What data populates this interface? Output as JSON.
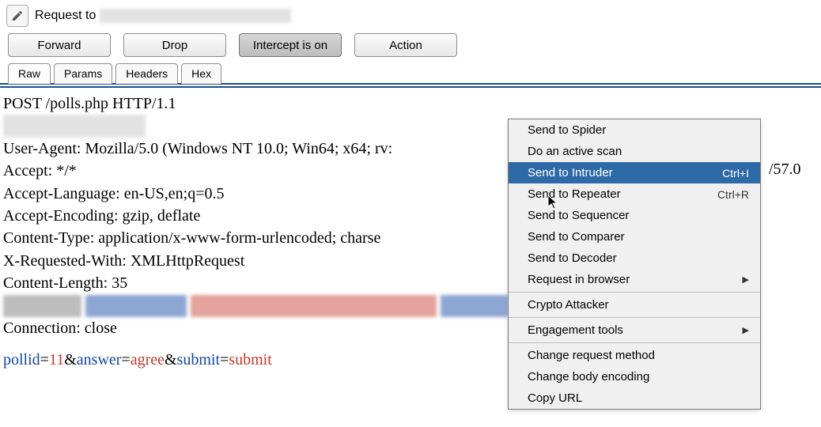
{
  "header": {
    "request_label_prefix": "Request to",
    "request_target_redacted": "████████████  [██ ██ █ ██]"
  },
  "buttons": {
    "forward": "Forward",
    "drop": "Drop",
    "intercept": "Intercept is on",
    "action": "Action"
  },
  "tabs": [
    "Raw",
    "Params",
    "Headers",
    "Hex"
  ],
  "active_tab": "Raw",
  "request": {
    "request_line": "POST /polls.php HTTP/1.1",
    "host_redacted": "████ ██████ ██",
    "user_agent": "User-Agent: Mozilla/5.0 (Windows NT 10.0; Win64; x64; rv:",
    "user_agent_suffix_visible": "/57.0",
    "accept": "Accept: */*",
    "accept_language": "Accept-Language: en-US,en;q=0.5",
    "accept_encoding": "Accept-Encoding: gzip, deflate",
    "content_type": "Content-Type: application/x-www-form-urlencoded; charse",
    "x_requested_with": "X-Requested-With: XMLHttpRequest",
    "content_length": "Content-Length: 35",
    "extra_row_redacted_black": "███████",
    "extra_row_redacted_blue": "█████████",
    "extra_row_redacted_red": "██████████████████████",
    "extra_row_redacted_blue2": "██████",
    "connection": "Connection: close",
    "form": {
      "k1": "pollid",
      "eq": "=",
      "v1": "11",
      "amp": "&",
      "k2": "answer",
      "v2": "agree",
      "k3": "submit",
      "v3": "submit"
    }
  },
  "context_menu": {
    "items": [
      {
        "label": "Send to Spider",
        "shortcut": "",
        "submenu": false
      },
      {
        "label": "Do an active scan",
        "shortcut": "",
        "submenu": false
      },
      {
        "label": "Send to Intruder",
        "shortcut": "Ctrl+I",
        "submenu": false,
        "highlight": true
      },
      {
        "label": "Send to Repeater",
        "shortcut": "Ctrl+R",
        "submenu": false
      },
      {
        "label": "Send to Sequencer",
        "shortcut": "",
        "submenu": false
      },
      {
        "label": "Send to Comparer",
        "shortcut": "",
        "submenu": false
      },
      {
        "label": "Send to Decoder",
        "shortcut": "",
        "submenu": false
      },
      {
        "label": "Request in browser",
        "shortcut": "",
        "submenu": true
      },
      {
        "sep": true
      },
      {
        "label": "Crypto Attacker",
        "shortcut": "",
        "submenu": false
      },
      {
        "sep": true
      },
      {
        "label": "Engagement tools",
        "shortcut": "",
        "submenu": true
      },
      {
        "sep": true
      },
      {
        "label": "Change request method",
        "shortcut": "",
        "submenu": false
      },
      {
        "label": "Change body encoding",
        "shortcut": "",
        "submenu": false
      },
      {
        "label": "Copy URL",
        "shortcut": "",
        "submenu": false
      }
    ]
  }
}
